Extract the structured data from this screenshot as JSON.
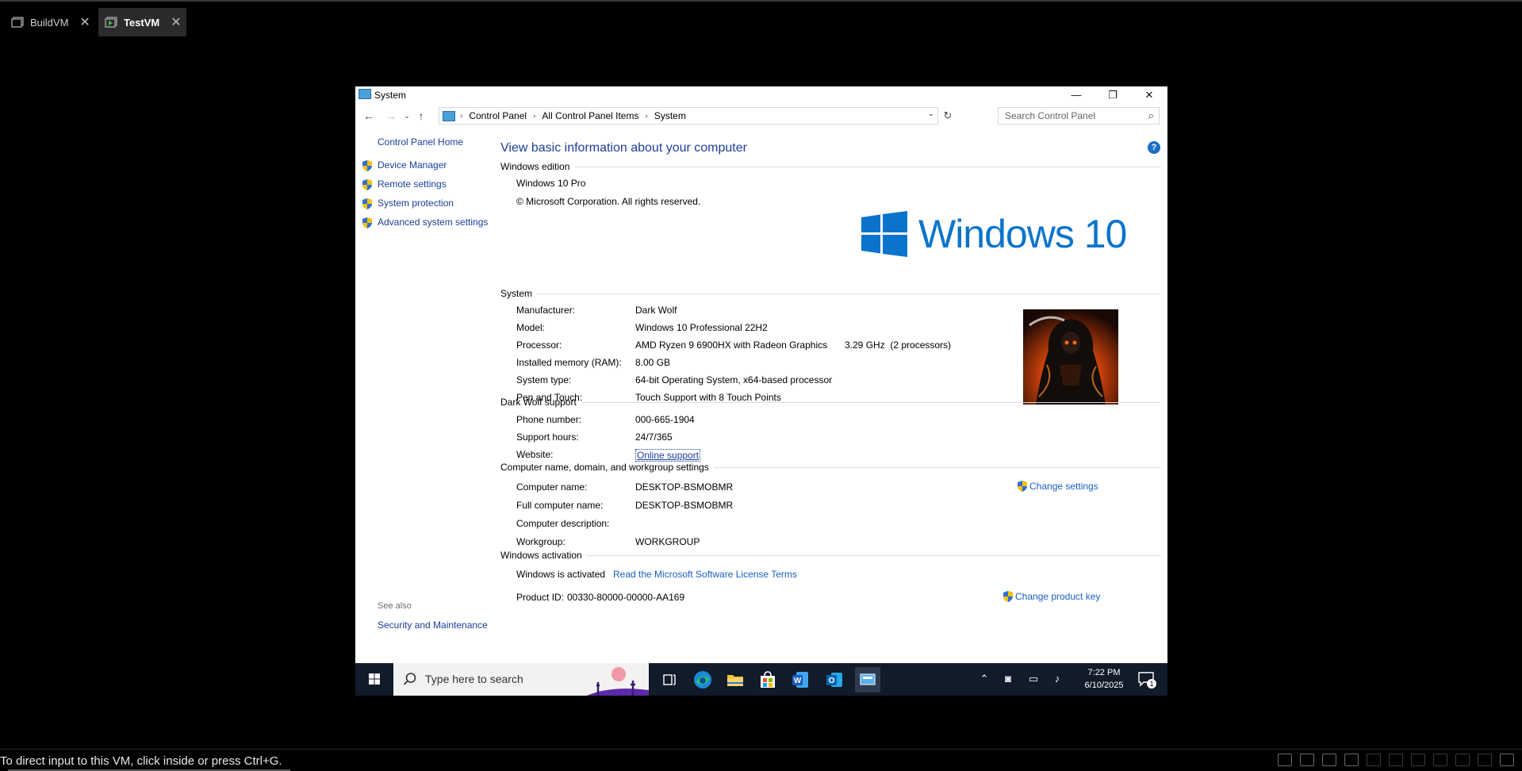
{
  "vm": {
    "tabs": [
      {
        "label": "BuildVM",
        "close": "✕"
      },
      {
        "label": "TestVM",
        "close": "✕"
      }
    ],
    "status_text": "To direct input to this VM, click inside or press Ctrl+G."
  },
  "window": {
    "title": "System",
    "controls": {
      "minimize": "—",
      "restore": "❐",
      "close": "✕"
    }
  },
  "address": {
    "breadcrumbs": [
      "Control Panel",
      "All Control Panel Items",
      "System"
    ],
    "search_placeholder": "Search Control Panel"
  },
  "left_pane": {
    "home": "Control Panel Home",
    "links": [
      "Device Manager",
      "Remote settings",
      "System protection",
      "Advanced system settings"
    ],
    "see_also": "See also",
    "see_also_links": [
      "Security and Maintenance"
    ]
  },
  "main": {
    "heading": "View basic information about your computer",
    "edition": {
      "title": "Windows edition",
      "name": "Windows 10 Pro",
      "copyright": "© Microsoft Corporation. All rights reserved.",
      "logo_text": "Windows 10"
    },
    "system": {
      "title": "System",
      "rows": [
        {
          "label": "Manufacturer:",
          "value": "Dark Wolf"
        },
        {
          "label": "Model:",
          "value": "Windows 10 Professional 22H2"
        },
        {
          "label": "Processor:",
          "value": "AMD Ryzen 9 6900HX with Radeon Graphics",
          "extra": "3.29 GHz  (2 processors)"
        },
        {
          "label": "Installed memory (RAM):",
          "value": "8.00 GB"
        },
        {
          "label": "System type:",
          "value": "64-bit Operating System, x64-based processor"
        },
        {
          "label": "Pen and Touch:",
          "value": "Touch Support with 8 Touch Points"
        }
      ]
    },
    "support": {
      "title": "Dark Wolf support",
      "rows": [
        {
          "label": "Phone number:",
          "value": "000-665-1904"
        },
        {
          "label": "Support hours:",
          "value": "24/7/365"
        },
        {
          "label": "Website:",
          "value": "Online support"
        }
      ]
    },
    "computer": {
      "title": "Computer name, domain, and workgroup settings",
      "rows": [
        {
          "label": "Computer name:",
          "value": "DESKTOP-BSMOBMR"
        },
        {
          "label": "Full computer name:",
          "value": "DESKTOP-BSMOBMR"
        },
        {
          "label": "Computer description:",
          "value": ""
        },
        {
          "label": "Workgroup:",
          "value": "WORKGROUP"
        }
      ],
      "change_settings": "Change settings"
    },
    "activation": {
      "title": "Windows activation",
      "status": "Windows is activated",
      "license_link": "Read the Microsoft Software License Terms",
      "product_id_label": "Product ID:",
      "product_id": "00330-80000-00000-AA169",
      "change_key": "Change product key"
    }
  },
  "taskbar": {
    "search_placeholder": "Type here to search",
    "time": "7:22 PM",
    "date": "6/10/2025",
    "notification_count": "1"
  },
  "colors": {
    "link": "#1a5fc1",
    "heading": "#1e3f9a",
    "windows_blue": "#0a74cc",
    "taskbar": "#111b2a"
  }
}
